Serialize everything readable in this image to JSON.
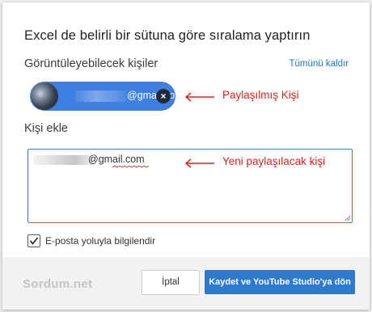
{
  "dialog": {
    "title": "Excel de belirli bir sütuna göre sıralama yaptırın",
    "viewers_label": "Görüntüleyebilecek kişiler",
    "remove_all_link": "Tümünü kaldır",
    "chip": {
      "email": "@gmail.com",
      "remove_icon": "close-icon"
    },
    "add_person_label": "Kişi ekle",
    "add_input_value": "@gmail.com",
    "notify_checkbox": {
      "label": "E-posta yoluyla bilgilendir",
      "checked": true
    }
  },
  "annotations": {
    "shared": "Paylaşılmış Kişi",
    "to_share": "Yeni paylaşılacak kişi",
    "color": "#e0241b"
  },
  "footer": {
    "brand": "Sordum.net",
    "cancel_label": "İptal",
    "save_label": "Kaydet ve YouTube Studio'ya dön"
  },
  "colors": {
    "accent": "#2f79cd",
    "chip": "#3f7fe0"
  }
}
